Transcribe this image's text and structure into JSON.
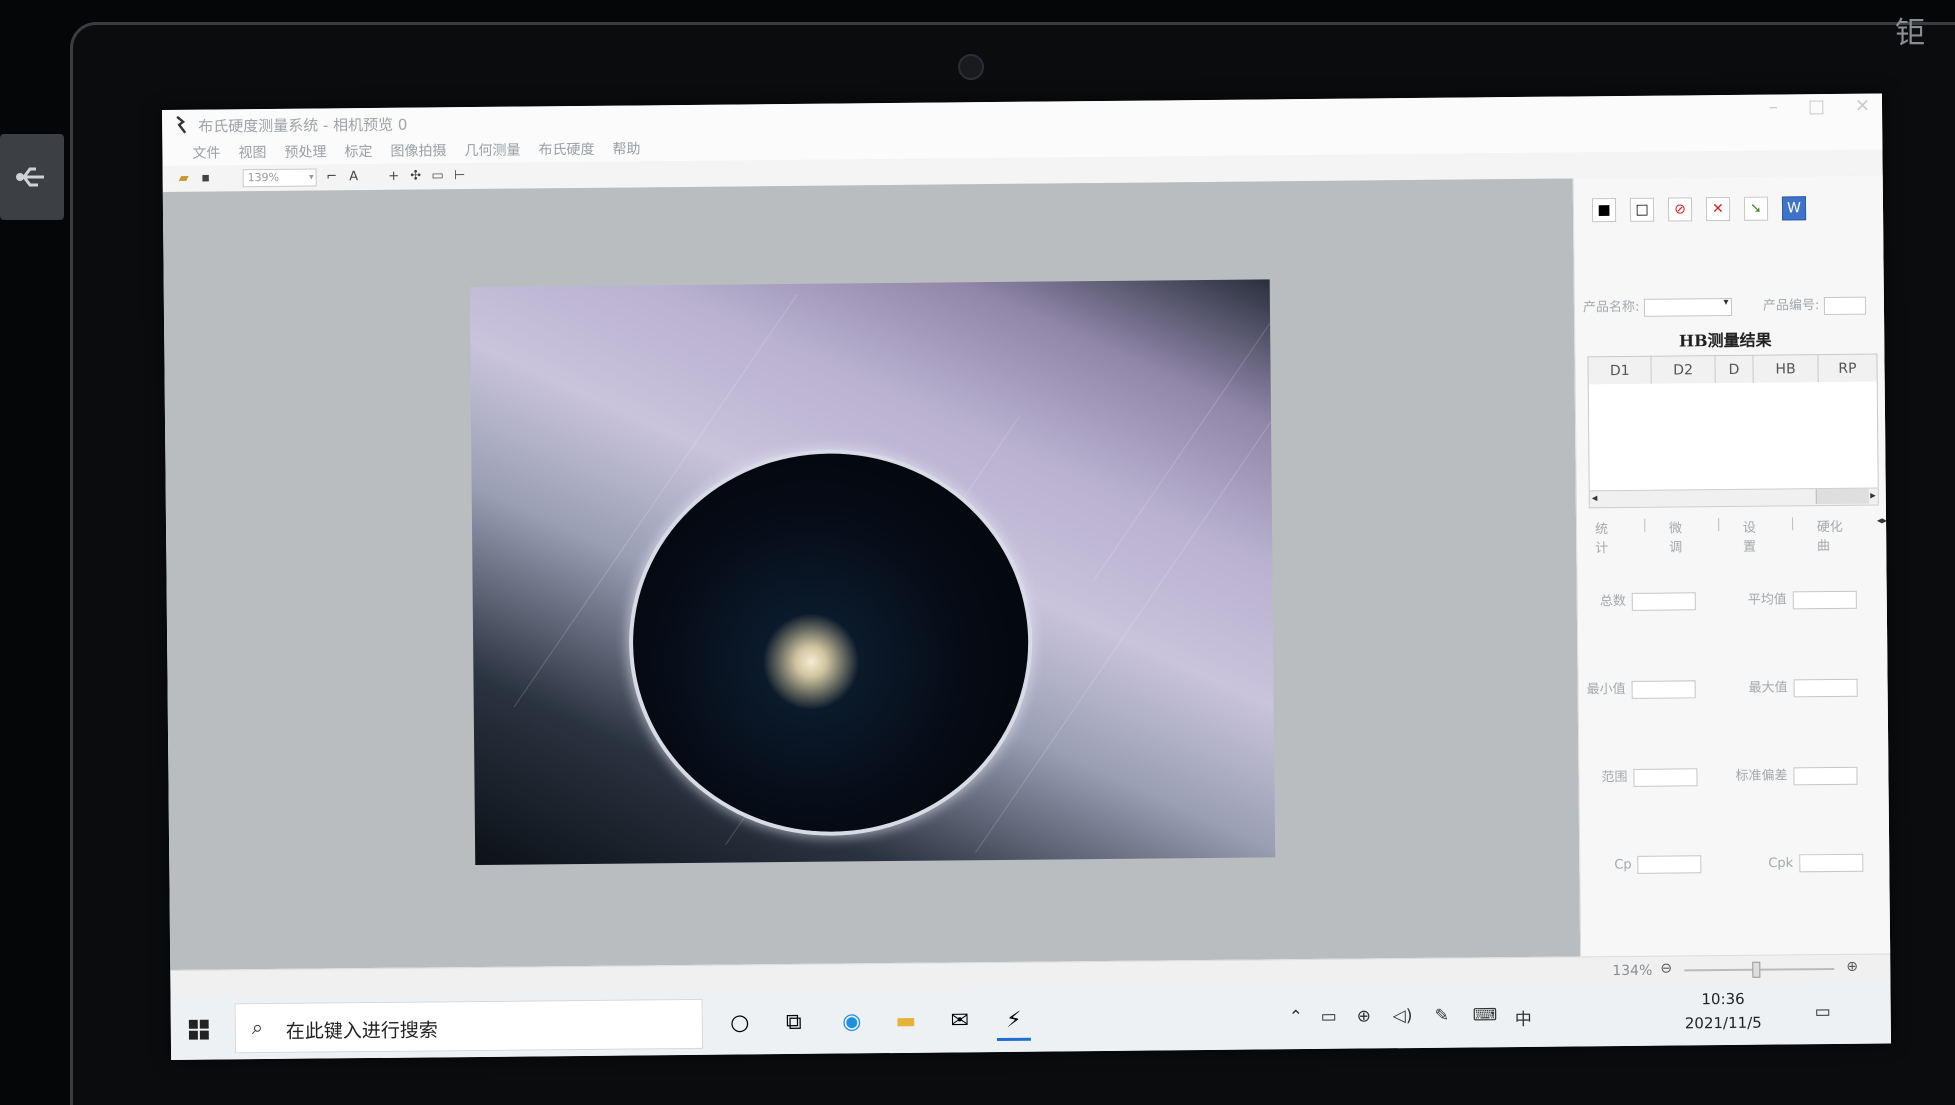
{
  "watermark": "钜",
  "window": {
    "title": "布氏硬度测量系统 - 相机预览 0"
  },
  "menu": [
    "文件",
    "视图",
    "预处理",
    "标定",
    "图像拍摄",
    "几何测量",
    "布氏硬度",
    "帮助"
  ],
  "toolbar": {
    "zoom_value": "139%",
    "text_tool": "A"
  },
  "panel": {
    "product_name_label": "产品名称:",
    "product_no_label": "产品编号:",
    "results_title": "HB测量结果",
    "columns": [
      "D1",
      "D2",
      "D",
      "HB",
      "RP"
    ],
    "tabs": [
      "统计",
      "微调",
      "设置",
      "硬化曲"
    ],
    "stats": {
      "total": "总数",
      "average": "平均值",
      "min": "最小值",
      "max": "最大值",
      "range": "范围",
      "std": "标准偏差",
      "cp": "Cp",
      "cpk": "Cpk"
    }
  },
  "statusbar": {
    "zoom": "134%"
  },
  "taskbar": {
    "search_placeholder": "在此键入进行搜索",
    "ime": "中",
    "time": "10:36",
    "date": "2021/11/5"
  }
}
